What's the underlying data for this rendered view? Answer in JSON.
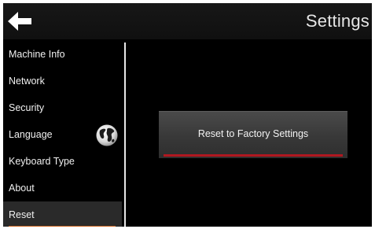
{
  "header": {
    "title": "Settings",
    "back_icon": "back-arrow-icon"
  },
  "sidebar": {
    "items": [
      {
        "label": "Machine Info"
      },
      {
        "label": "Network"
      },
      {
        "label": "Security"
      },
      {
        "label": "Language"
      },
      {
        "label": "Keyboard Type"
      },
      {
        "label": "About"
      },
      {
        "label": "Reset",
        "selected": true
      }
    ],
    "language_icon": "globe-icon"
  },
  "main": {
    "reset_button_label": "Reset to Factory Settings"
  },
  "colors": {
    "background": "#000000",
    "selected_underline": "#d06a26",
    "button_underline": "#b01820",
    "text": "#f0f0f0"
  }
}
